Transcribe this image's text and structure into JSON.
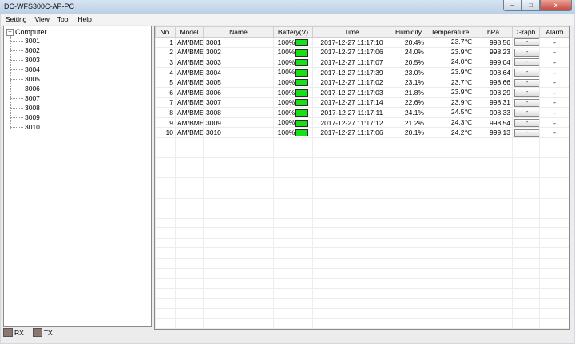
{
  "window": {
    "title": "DC-WFS300C-AP-PC"
  },
  "window_controls": {
    "minimize": "–",
    "maximize": "□",
    "close": "x"
  },
  "menu": [
    "Setting",
    "View",
    "Tool",
    "Help"
  ],
  "tree": {
    "root": "Computer",
    "expander": "–",
    "children": [
      "3001",
      "3002",
      "3003",
      "3004",
      "3005",
      "3006",
      "3007",
      "3008",
      "3009",
      "3010"
    ]
  },
  "status": {
    "rx": "RX",
    "tx": "TX"
  },
  "table": {
    "columns": [
      "No.",
      "Model",
      "Name",
      "Battery(V)",
      "Time",
      "Humidity",
      "Temperature",
      "hPa",
      "Graph",
      "Alarm"
    ],
    "rows": [
      {
        "no": "1",
        "model": "AM/BME",
        "name": "3001",
        "battery": "100%",
        "time": "2017-12-27 11:17:10",
        "humidity": "20.4%",
        "temperature": "23.7℃",
        "hpa": "998.56",
        "graph": "-",
        "alarm": "-"
      },
      {
        "no": "2",
        "model": "AM/BME",
        "name": "3002",
        "battery": "100%",
        "time": "2017-12-27 11:17:06",
        "humidity": "24.0%",
        "temperature": "23.9℃",
        "hpa": "998.23",
        "graph": "-",
        "alarm": "-"
      },
      {
        "no": "3",
        "model": "AM/BME",
        "name": "3003",
        "battery": "100%",
        "time": "2017-12-27 11:17:07",
        "humidity": "20.5%",
        "temperature": "24.0℃",
        "hpa": "999.04",
        "graph": "-",
        "alarm": "-"
      },
      {
        "no": "4",
        "model": "AM/BME",
        "name": "3004",
        "battery": "100%",
        "time": "2017-12-27 11:17:39",
        "humidity": "23.0%",
        "temperature": "23.9℃",
        "hpa": "998.64",
        "graph": "-",
        "alarm": "-"
      },
      {
        "no": "5",
        "model": "AM/BME",
        "name": "3005",
        "battery": "100%",
        "time": "2017-12-27 11:17:02",
        "humidity": "23.1%",
        "temperature": "23.7℃",
        "hpa": "998.66",
        "graph": "-",
        "alarm": "-"
      },
      {
        "no": "6",
        "model": "AM/BME",
        "name": "3006",
        "battery": "100%",
        "time": "2017-12-27 11:17:03",
        "humidity": "21.8%",
        "temperature": "23.9℃",
        "hpa": "998.29",
        "graph": "-",
        "alarm": "-"
      },
      {
        "no": "7",
        "model": "AM/BME",
        "name": "3007",
        "battery": "100%",
        "time": "2017-12-27 11:17:14",
        "humidity": "22.6%",
        "temperature": "23.9℃",
        "hpa": "998.31",
        "graph": "-",
        "alarm": "-"
      },
      {
        "no": "8",
        "model": "AM/BME",
        "name": "3008",
        "battery": "100%",
        "time": "2017-12-27 11:17:11",
        "humidity": "24.1%",
        "temperature": "24.5℃",
        "hpa": "998.33",
        "graph": "-",
        "alarm": "-"
      },
      {
        "no": "9",
        "model": "AM/BME",
        "name": "3009",
        "battery": "100%",
        "time": "2017-12-27 11:17:12",
        "humidity": "21.2%",
        "temperature": "24.3℃",
        "hpa": "998.54",
        "graph": "-",
        "alarm": "-"
      },
      {
        "no": "10",
        "model": "AM/BME",
        "name": "3010",
        "battery": "100%",
        "time": "2017-12-27 11:17:06",
        "humidity": "20.1%",
        "temperature": "24.2℃",
        "hpa": "999.13",
        "graph": "-",
        "alarm": "-"
      }
    ]
  },
  "colors": {
    "battery_fill": "#18e018",
    "indicator": "#8a7770",
    "close_button": "#c6463a"
  }
}
